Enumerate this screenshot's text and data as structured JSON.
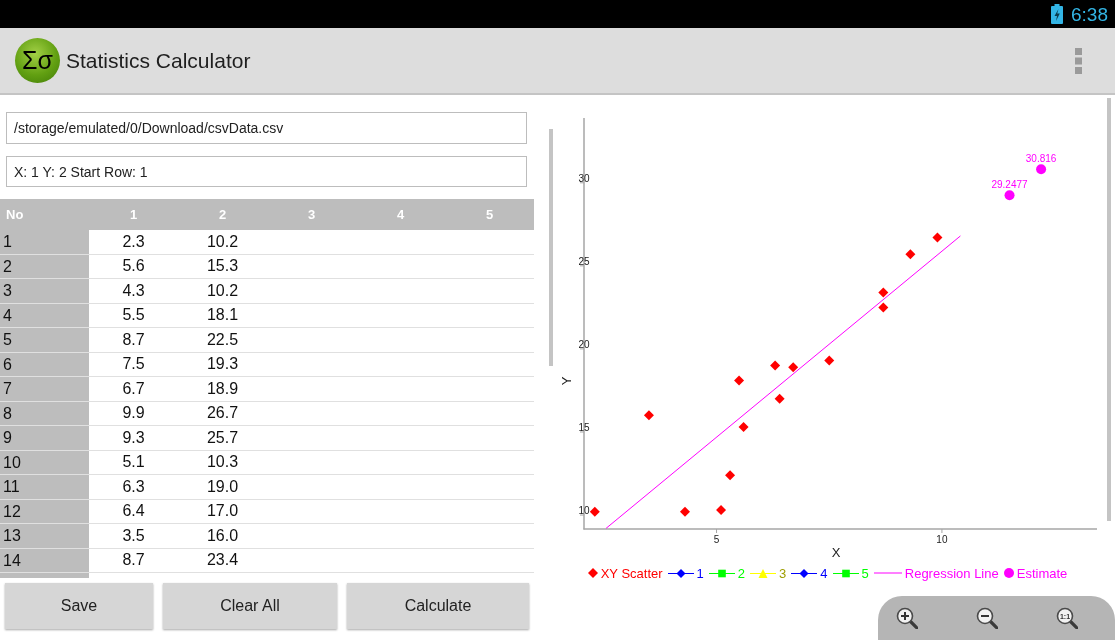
{
  "status_bar": {
    "time": "6:38"
  },
  "app_bar": {
    "logo_text": "Σσ",
    "title": "Statistics Calculator"
  },
  "file_field": {
    "value": "/storage/emulated/0/Download/csvData.csv"
  },
  "columns_field": {
    "value": "X: 1 Y: 2 Start Row: 1"
  },
  "table": {
    "columns": [
      "No",
      "1",
      "2",
      "3",
      "4",
      "5"
    ],
    "rows": [
      {
        "cells": [
          "1",
          "2.3",
          "10.2"
        ]
      },
      {
        "cells": [
          "2",
          "5.6",
          "15.3"
        ]
      },
      {
        "cells": [
          "3",
          "4.3",
          "10.2"
        ]
      },
      {
        "cells": [
          "4",
          "5.5",
          "18.1"
        ]
      },
      {
        "cells": [
          "5",
          "8.7",
          "22.5"
        ]
      },
      {
        "cells": [
          "6",
          "7.5",
          "19.3"
        ]
      },
      {
        "cells": [
          "7",
          "6.7",
          "18.9"
        ]
      },
      {
        "cells": [
          "8",
          "9.9",
          "26.7"
        ]
      },
      {
        "cells": [
          "9",
          "9.3",
          "25.7"
        ]
      },
      {
        "cells": [
          "10",
          "5.1",
          "10.3"
        ]
      },
      {
        "cells": [
          "11",
          "6.3",
          "19.0"
        ]
      },
      {
        "cells": [
          "12",
          "6.4",
          "17.0"
        ]
      },
      {
        "cells": [
          "13",
          "3.5",
          "16.0"
        ]
      },
      {
        "cells": [
          "14",
          "8.7",
          "23.4"
        ]
      }
    ]
  },
  "buttons": [
    "Save",
    "Clear All",
    "Calculate"
  ],
  "chart": {
    "chart_data": {
      "type": "scatter",
      "xlabel": "X",
      "ylabel": "Y",
      "xlim": [
        2.06,
        13.44
      ],
      "ylim": [
        9.16,
        33.9
      ],
      "xticks": [
        5,
        10
      ],
      "yticks": [
        10,
        15,
        20,
        25,
        30
      ],
      "series": [
        {
          "name": "XY Scatter",
          "color": "#ff0000",
          "type": "scatter",
          "marker": "diamond",
          "x": [
            2.3,
            5.6,
            4.3,
            5.5,
            8.7,
            7.5,
            6.7,
            9.9,
            9.3,
            5.1,
            6.3,
            6.4,
            3.5,
            8.7,
            5.3
          ],
          "values": [
            10.2,
            15.3,
            10.2,
            18.1,
            22.5,
            19.3,
            18.9,
            26.7,
            25.7,
            10.3,
            19.0,
            17.0,
            16.0,
            23.4,
            12.4
          ]
        },
        {
          "name": "1",
          "color": "#0000ff",
          "type": "line",
          "marker": "diamond"
        },
        {
          "name": "2",
          "color": "#00ff00",
          "type": "line",
          "marker": "square"
        },
        {
          "name": "3",
          "color": "#ffff00",
          "type": "line",
          "marker": "triangle"
        },
        {
          "name": "4",
          "color": "#0000ff",
          "type": "line",
          "marker": "diamond"
        },
        {
          "name": "5",
          "color": "#00ff00",
          "type": "line",
          "marker": "square"
        },
        {
          "name": "Regression Line",
          "color": "#ff00ff",
          "type": "line",
          "x": [
            2.55,
            10.41
          ],
          "values": [
            9.2,
            26.8
          ]
        },
        {
          "name": "Estimate",
          "color": "#ff00ff",
          "type": "scatter",
          "marker": "circle",
          "x": [
            11.5,
            12.2
          ],
          "values": [
            29.2477,
            30.816
          ],
          "value_labels": [
            "29.2477",
            "30.816"
          ]
        }
      ]
    }
  },
  "zoom_controls": {
    "reset_label": "1:1"
  }
}
